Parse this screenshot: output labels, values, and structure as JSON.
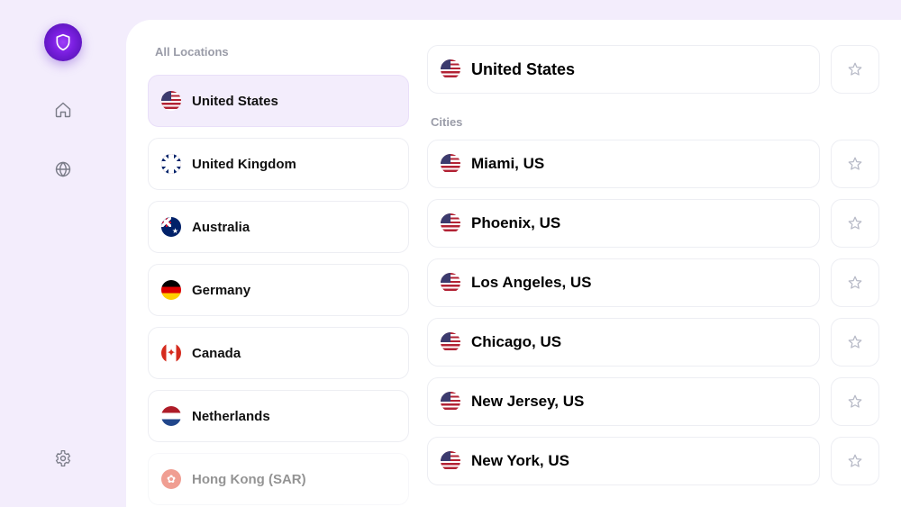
{
  "section_all": "All Locations",
  "section_cities": "Cities",
  "countries": [
    {
      "label": "United States",
      "flag": "us",
      "selected": true
    },
    {
      "label": "United Kingdom",
      "flag": "uk"
    },
    {
      "label": "Australia",
      "flag": "au"
    },
    {
      "label": "Germany",
      "flag": "de"
    },
    {
      "label": "Canada",
      "flag": "ca"
    },
    {
      "label": "Netherlands",
      "flag": "nl"
    },
    {
      "label": "Hong Kong (SAR)",
      "flag": "hk",
      "faded": true
    }
  ],
  "selected_country": {
    "label": "United States",
    "flag": "us"
  },
  "cities": [
    {
      "label": "Miami, US",
      "flag": "us"
    },
    {
      "label": "Phoenix, US",
      "flag": "us"
    },
    {
      "label": "Los Angeles, US",
      "flag": "us"
    },
    {
      "label": "Chicago, US",
      "flag": "us"
    },
    {
      "label": "New Jersey, US",
      "flag": "us"
    },
    {
      "label": "New York, US",
      "flag": "us"
    }
  ]
}
